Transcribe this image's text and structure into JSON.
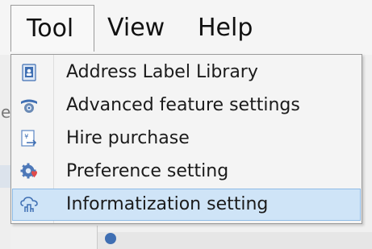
{
  "menubar": {
    "items": [
      {
        "label": "Tool"
      },
      {
        "label": "View"
      },
      {
        "label": "Help"
      }
    ]
  },
  "tool_menu": {
    "items": [
      {
        "label": "Address Label Library",
        "icon": "address-book-icon"
      },
      {
        "label": "Advanced feature settings",
        "icon": "advanced-settings-icon"
      },
      {
        "label": "Hire purchase",
        "icon": "hire-purchase-icon"
      },
      {
        "label": "Preference setting",
        "icon": "preference-gear-icon"
      },
      {
        "label": "Informatization setting",
        "icon": "informatization-cloud-icon",
        "highlighted": true
      }
    ]
  },
  "background": {
    "partial_text": "e"
  },
  "colors": {
    "highlight_bg": "#cfe4f7",
    "highlight_border": "#8fbbe6",
    "menu_bg": "#f4f4f4",
    "icon_blue": "#3f6fb3",
    "icon_red": "#e04a4a"
  }
}
